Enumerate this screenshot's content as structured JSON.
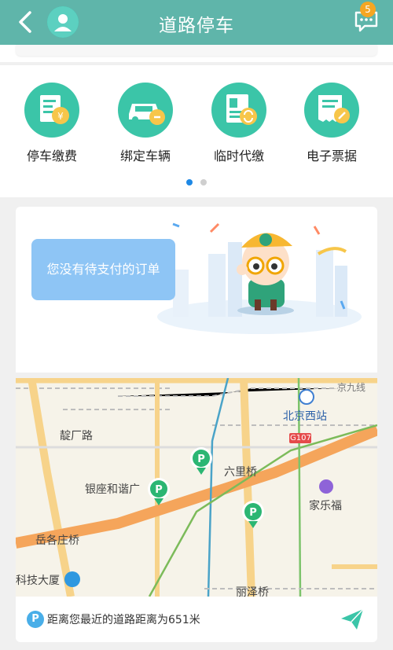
{
  "header": {
    "title": "道路停车",
    "notification_count": "5",
    "icons": [
      "back-arrow",
      "user-avatar",
      "message"
    ]
  },
  "services": {
    "items": [
      {
        "label": "停车缴费",
        "icon": "parking-payment"
      },
      {
        "label": "绑定车辆",
        "icon": "bind-vehicle"
      },
      {
        "label": "临时代缴",
        "icon": "temporary-payment"
      },
      {
        "label": "电子票据",
        "icon": "e-receipt"
      }
    ],
    "page_indicator": {
      "current": 1,
      "total": 2
    }
  },
  "order": {
    "empty_text": "您没有待支付的订单"
  },
  "map": {
    "labels": {
      "dingchang_road": "靛厂路",
      "beijing_west": "北京西站",
      "g107": "G107",
      "liuliqiao": "六里桥",
      "yinzuo": "银座和谐广",
      "carrefour": "家乐福",
      "yuegezhuang": "岳各庄桥",
      "keji": "科技大厦",
      "lize": "丽泽桥",
      "jingjiu": "京九线"
    }
  },
  "footer": {
    "p_symbol": "P",
    "distance_text": "距离您最近的道路距离为651米"
  },
  "colors": {
    "header": "#5fb5aa",
    "accent_green": "#3bc5a8",
    "active_dot": "#1e88e5",
    "bubble": "#8ec5f5",
    "parking_marker": "#2bb673"
  }
}
